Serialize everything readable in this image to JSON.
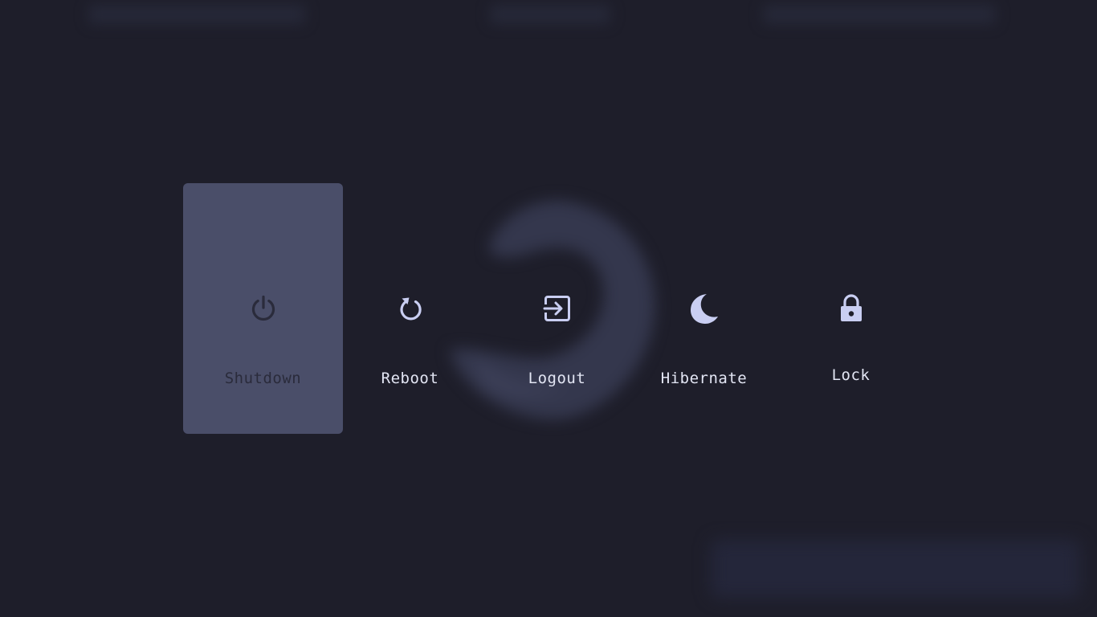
{
  "menu": {
    "options": [
      {
        "label": "Shutdown",
        "icon": "power-icon",
        "selected": true
      },
      {
        "label": "Reboot",
        "icon": "reboot-icon",
        "selected": false
      },
      {
        "label": "Logout",
        "icon": "logout-icon",
        "selected": false
      },
      {
        "label": "Hibernate",
        "icon": "moon-icon",
        "selected": false
      },
      {
        "label": "Lock",
        "icon": "lock-icon",
        "selected": false
      }
    ]
  },
  "colors": {
    "background": "#1e1e2a",
    "selected_tile": "#4a4e69",
    "icon": "#c9cef2",
    "selected_icon": "#2a2b3b",
    "label": "#e3e6f4"
  }
}
